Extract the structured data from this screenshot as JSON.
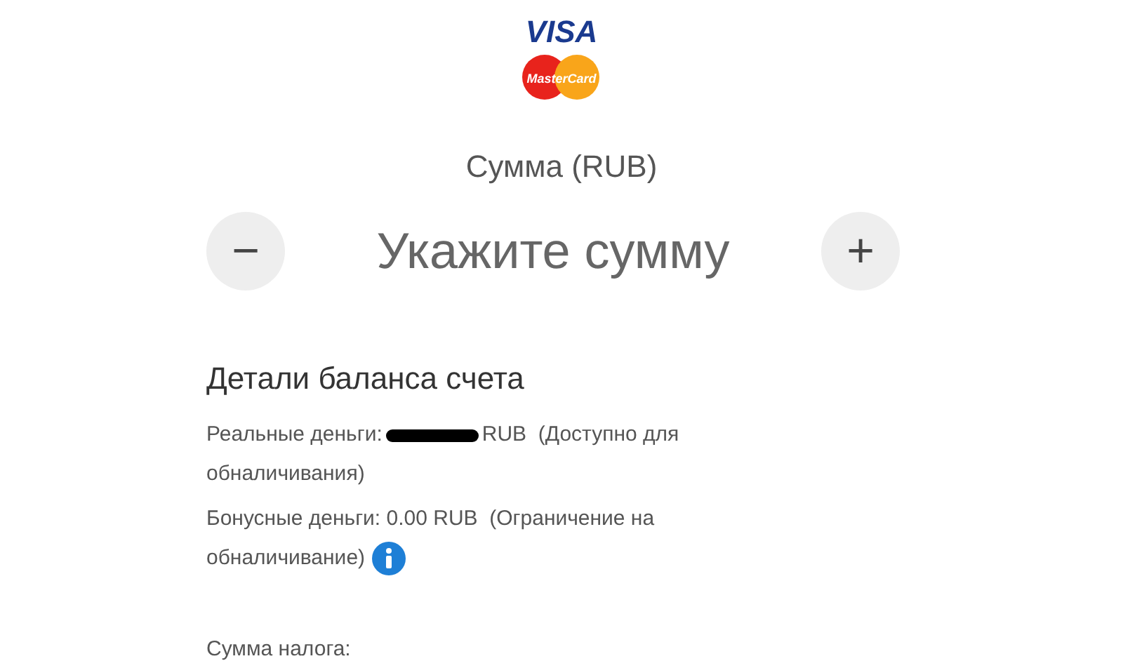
{
  "logos": {
    "visa": "VISA",
    "mastercard": "MasterCard"
  },
  "amount": {
    "title": "Сумма (RUB)",
    "placeholder": "Укажите сумму",
    "decrease": "−",
    "increase": "+"
  },
  "balance": {
    "heading": "Детали баланса счета",
    "real": {
      "label": "Реальные деньги:",
      "redacted": true,
      "rest": "RUB  (Доступно для",
      "continued": "обналичивания)"
    },
    "bonus": {
      "text": "Бонусные деньги: 0.00 RUB  (Ограничение на",
      "continued": "обналичивание)",
      "info": true
    }
  },
  "tax": {
    "label": "Сумма налога:"
  }
}
